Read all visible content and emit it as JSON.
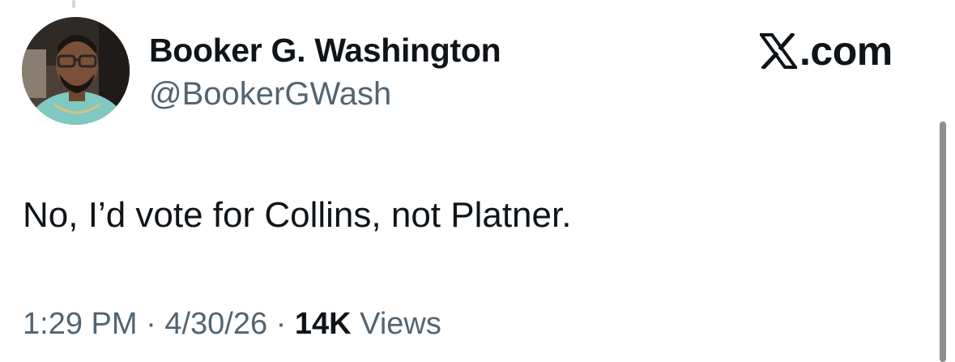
{
  "author": {
    "display_name": "Booker G. Washington",
    "handle": "@BookerGWash",
    "avatar_icon": "profile-photo"
  },
  "brand": {
    "logo_icon": "x-logo-icon",
    "suffix": ".com"
  },
  "tweet": {
    "text": "No, I’d vote for Collins, not Platner."
  },
  "meta": {
    "time": "1:29 PM",
    "separator": " · ",
    "date": "4/30/26",
    "views_count": "14K",
    "views_label": " Views"
  },
  "colors": {
    "text_primary": "#0f1419",
    "text_secondary": "#536471",
    "background": "#ffffff"
  }
}
